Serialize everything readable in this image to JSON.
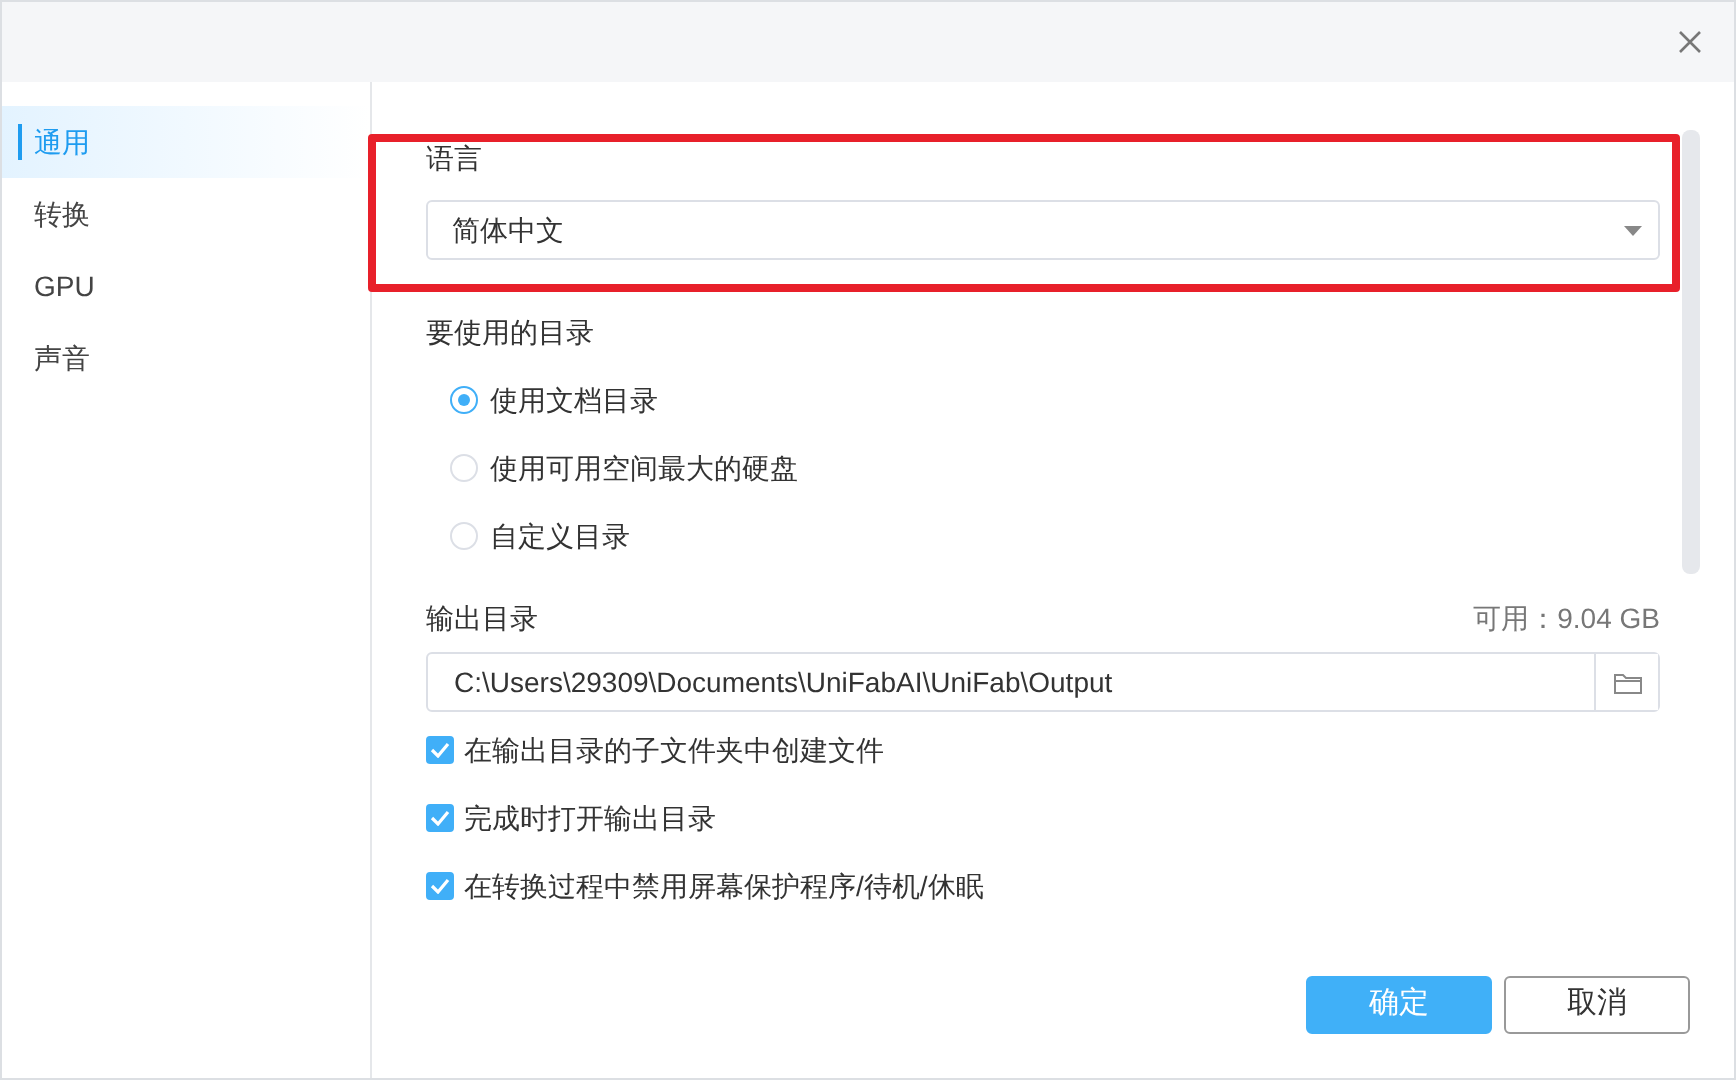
{
  "sidebar": {
    "items": [
      {
        "label": "通用",
        "selected": true
      },
      {
        "label": "转换",
        "selected": false
      },
      {
        "label": "GPU",
        "selected": false
      },
      {
        "label": "声音",
        "selected": false
      }
    ]
  },
  "language": {
    "label": "语言",
    "value": "简体中文"
  },
  "directory": {
    "label": "要使用的目录",
    "options": [
      {
        "label": "使用文档目录",
        "selected": true
      },
      {
        "label": "使用可用空间最大的硬盘",
        "selected": false
      },
      {
        "label": "自定义目录",
        "selected": false
      }
    ]
  },
  "output": {
    "label": "输出目录",
    "free_space": "可用：9.04 GB",
    "path": "C:\\Users\\29309\\Documents\\UniFabAI\\UniFab\\Output"
  },
  "checkboxes": [
    {
      "label": "在输出目录的子文件夹中创建文件",
      "checked": true
    },
    {
      "label": "完成时打开输出目录",
      "checked": true
    },
    {
      "label": "在转换过程中禁用屏幕保护程序/待机/休眠",
      "checked": true
    }
  ],
  "buttons": [
    {
      "label": "确定",
      "kind": "primary"
    },
    {
      "label": "取消",
      "kind": "secondary"
    }
  ]
}
